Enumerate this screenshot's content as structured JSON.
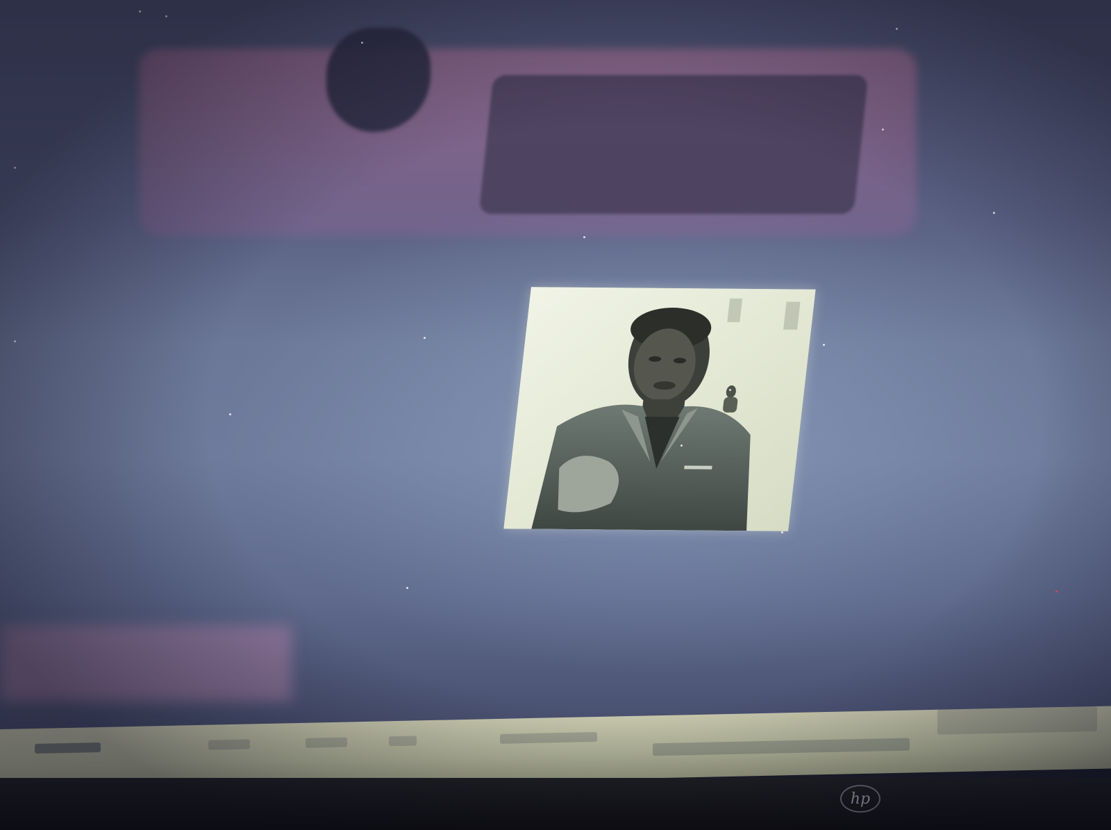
{
  "scene": {
    "description_type": "photo-of-monitor",
    "bezel": {
      "brand_logo_text": "hp"
    },
    "colors": {
      "screen_base": "#5a6183",
      "reflection_pink": "#be78a0",
      "taskbar": "#c9c9ae",
      "photo_paper": "#e8edd6",
      "bezel": "#141417"
    }
  }
}
